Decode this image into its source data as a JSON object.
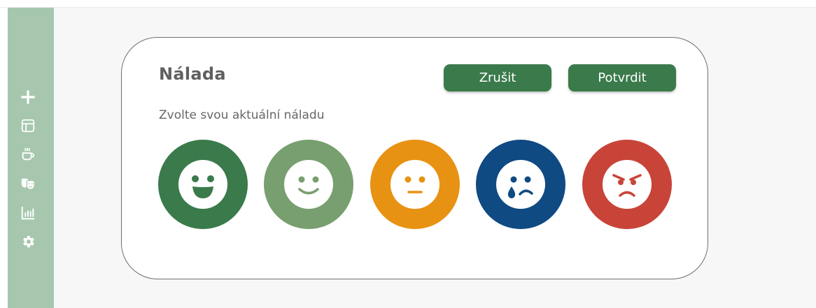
{
  "sidebar": {
    "background": "#a6c7ae",
    "icons": [
      "plus-icon",
      "layout-icon",
      "coffee-cup-icon",
      "theater-masks-icon",
      "bar-chart-icon",
      "gear-icon"
    ]
  },
  "dialog": {
    "title": "Nálada",
    "subtitle": "Zvolte svou aktuální náladu",
    "cancel_label": "Zrušit",
    "confirm_label": "Potvrdit",
    "button_color": "#3a7a4b"
  },
  "moods": [
    {
      "icon": "grin-face-icon",
      "color": "#3a7a4b"
    },
    {
      "icon": "smile-face-icon",
      "color": "#789f6f"
    },
    {
      "icon": "neutral-face-icon",
      "color": "#e89213"
    },
    {
      "icon": "crying-face-icon",
      "color": "#0f4a82"
    },
    {
      "icon": "angry-face-icon",
      "color": "#c84439"
    }
  ]
}
